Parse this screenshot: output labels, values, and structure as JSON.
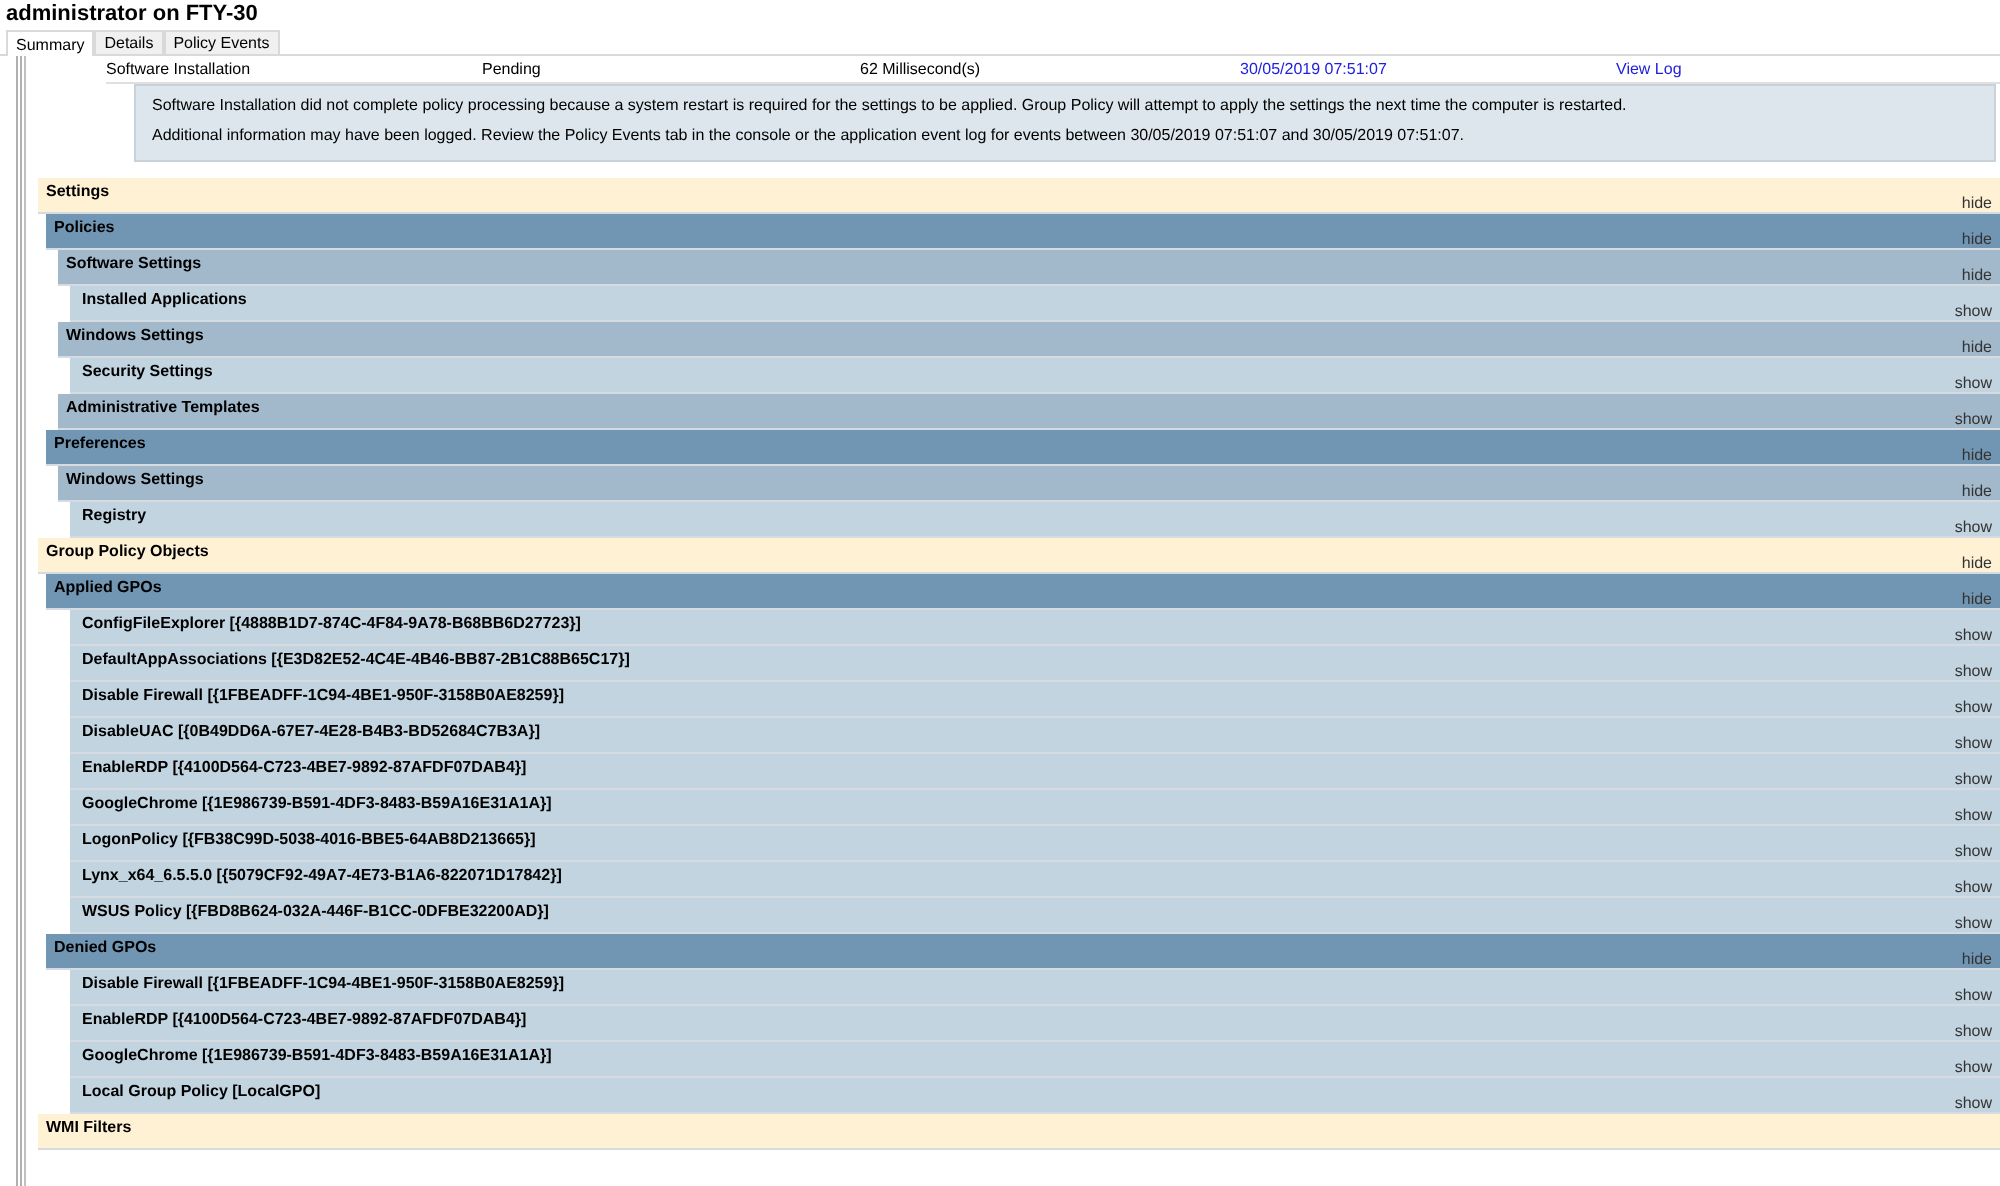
{
  "window": {
    "title": "administrator on FTY-30"
  },
  "tabs": [
    {
      "label": "Summary",
      "selected": true
    },
    {
      "label": "Details",
      "selected": false
    },
    {
      "label": "Policy Events",
      "selected": false
    }
  ],
  "component_row": {
    "name": "Software Installation",
    "status": "Pending",
    "duration": "62 Millisecond(s)",
    "date": "30/05/2019 07:51:07",
    "view_log": "View Log"
  },
  "message": [
    "Software Installation did not complete policy processing because a system restart is required for the settings to be applied. Group Policy will attempt to apply the settings the next time the computer is restarted.",
    "Additional information may have been logged. Review the Policy Events tab in the console or the application event log for events between 30/05/2019 07:51:07 and 30/05/2019 07:51:07."
  ],
  "sections": [
    {
      "title": "Settings",
      "kind": "category",
      "toggle": "hide",
      "children": [
        {
          "title": "Policies",
          "kind": "group",
          "toggle": "hide",
          "children": [
            {
              "title": "Software Settings",
              "kind": "subgroup",
              "toggle": "hide",
              "children": [
                {
                  "title": "Installed Applications",
                  "kind": "item",
                  "toggle": "show"
                }
              ]
            },
            {
              "title": "Windows Settings",
              "kind": "subgroup",
              "toggle": "hide",
              "children": [
                {
                  "title": "Security Settings",
                  "kind": "item",
                  "toggle": "show"
                }
              ]
            },
            {
              "title": "Administrative Templates",
              "kind": "subgroup",
              "toggle": "show"
            }
          ]
        },
        {
          "title": "Preferences",
          "kind": "group",
          "toggle": "hide",
          "children": [
            {
              "title": "Windows Settings",
              "kind": "subgroup",
              "toggle": "hide",
              "children": [
                {
                  "title": "Registry",
                  "kind": "item",
                  "toggle": "show"
                }
              ]
            }
          ]
        }
      ]
    },
    {
      "title": "Group Policy Objects",
      "kind": "category",
      "toggle": "hide",
      "children": [
        {
          "title": "Applied GPOs",
          "kind": "group",
          "toggle": "hide",
          "children": [
            {
              "title": "ConfigFileExplorer [{4888B1D7-874C-4F84-9A78-B68BB6D27723}]",
              "kind": "item",
              "toggle": "show"
            },
            {
              "title": "DefaultAppAssociations [{E3D82E52-4C4E-4B46-BB87-2B1C88B65C17}]",
              "kind": "item",
              "toggle": "show"
            },
            {
              "title": "Disable Firewall [{1FBEADFF-1C94-4BE1-950F-3158B0AE8259}]",
              "kind": "item",
              "toggle": "show"
            },
            {
              "title": "DisableUAC [{0B49DD6A-67E7-4E28-B4B3-BD52684C7B3A}]",
              "kind": "item",
              "toggle": "show"
            },
            {
              "title": "EnableRDP [{4100D564-C723-4BE7-9892-87AFDF07DAB4}]",
              "kind": "item",
              "toggle": "show"
            },
            {
              "title": "GoogleChrome [{1E986739-B591-4DF3-8483-B59A16E31A1A}]",
              "kind": "item",
              "toggle": "show"
            },
            {
              "title": "LogonPolicy [{FB38C99D-5038-4016-BBE5-64AB8D213665}]",
              "kind": "item",
              "toggle": "show"
            },
            {
              "title": "Lynx_x64_6.5.5.0 [{5079CF92-49A7-4E73-B1A6-822071D17842}]",
              "kind": "item",
              "toggle": "show"
            },
            {
              "title": "WSUS Policy [{FBD8B624-032A-446F-B1CC-0DFBE32200AD}]",
              "kind": "item",
              "toggle": "show"
            }
          ]
        },
        {
          "title": "Denied GPOs",
          "kind": "group",
          "toggle": "hide",
          "children": [
            {
              "title": "Disable Firewall [{1FBEADFF-1C94-4BE1-950F-3158B0AE8259}]",
              "kind": "item",
              "toggle": "show"
            },
            {
              "title": "EnableRDP [{4100D564-C723-4BE7-9892-87AFDF07DAB4}]",
              "kind": "item",
              "toggle": "show"
            },
            {
              "title": "GoogleChrome [{1E986739-B591-4DF3-8483-B59A16E31A1A}]",
              "kind": "item",
              "toggle": "show"
            },
            {
              "title": "Local Group Policy [LocalGPO]",
              "kind": "item",
              "toggle": "show"
            }
          ]
        }
      ]
    },
    {
      "title": "WMI Filters",
      "kind": "category"
    }
  ]
}
